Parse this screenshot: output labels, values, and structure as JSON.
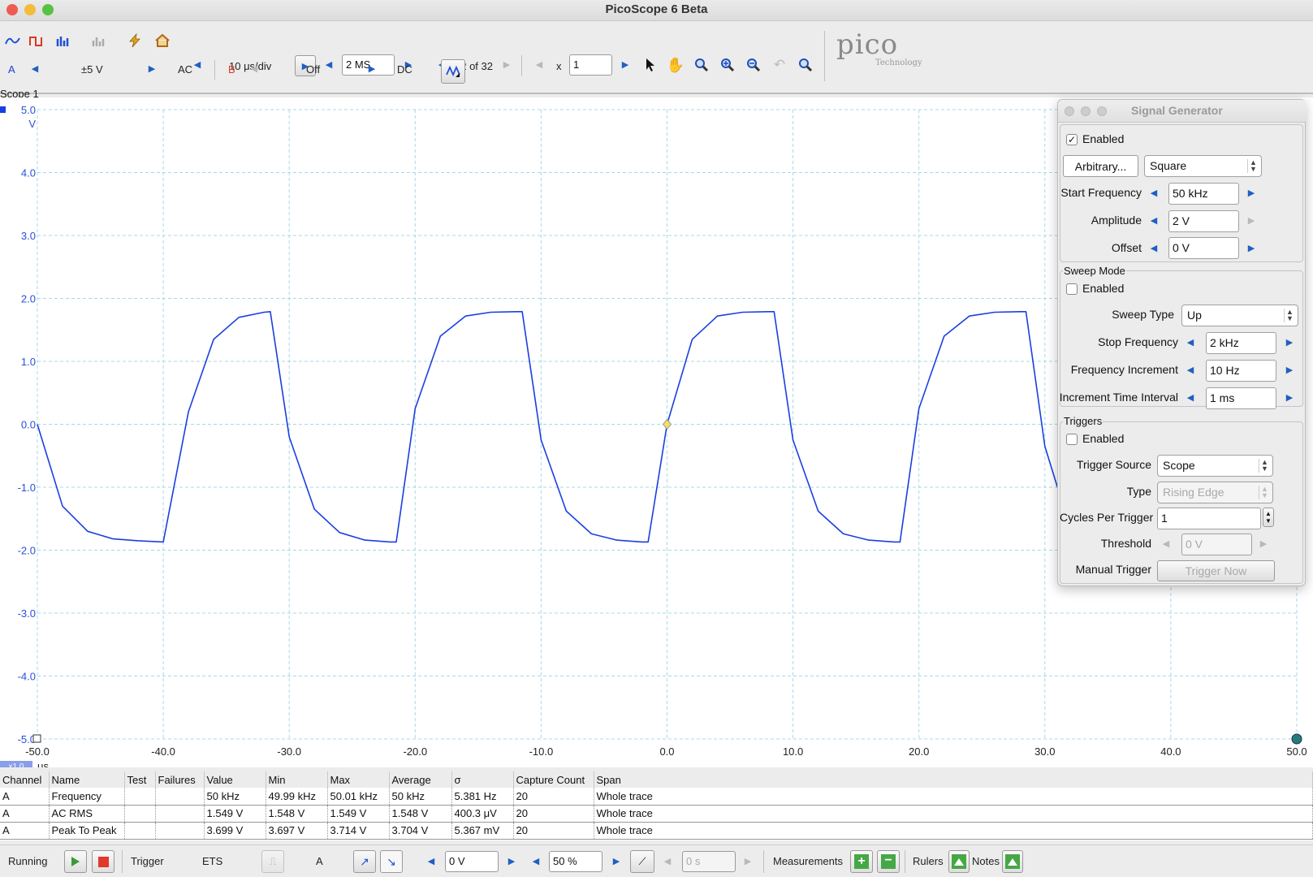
{
  "window": {
    "title": "PicoScope 6 Beta"
  },
  "toolbar": {
    "timebase": "10 μs/div",
    "samples": "2 MS",
    "buffer": "32 of 32",
    "zoom_prefix": "x",
    "zoom_value": "1"
  },
  "channels": {
    "a_label": "A",
    "a_range": "±5 V",
    "a_coupling": "AC",
    "b_label": "B",
    "b_range": "Off",
    "b_coupling": "DC"
  },
  "logo": {
    "brand": "pico",
    "sub": "Technology"
  },
  "scope": {
    "label": "Scope 1",
    "x_scale": "x1.0",
    "x_unit": "μs",
    "y_unit": "V"
  },
  "chart_data": {
    "type": "line",
    "xlim": [
      -50,
      50
    ],
    "ylim": [
      -5,
      5
    ],
    "x_ticks": [
      "-50.0",
      "-40.0",
      "-30.0",
      "-20.0",
      "-10.0",
      "0.0",
      "10.0",
      "20.0",
      "30.0",
      "40.0",
      "50.0"
    ],
    "y_ticks": [
      "5.0",
      "4.0",
      "3.0",
      "2.0",
      "1.0",
      "0.0",
      "-1.0",
      "-2.0",
      "-3.0",
      "-4.0",
      "-5.0"
    ],
    "xlabel": "μs",
    "ylabel": "V",
    "grid": true,
    "series": [
      {
        "color": "#1a3fe0",
        "x": [
          -50,
          -48,
          -46,
          -44,
          -42,
          -40,
          -38,
          -36,
          -34,
          -32,
          -31.5,
          -30,
          -28,
          -26,
          -24,
          -22,
          -21.5,
          -20,
          -18,
          -16,
          -14,
          -12,
          -11.5,
          -10,
          -8,
          -6,
          -4,
          -2,
          -1.5,
          0,
          2,
          4,
          6,
          8,
          8.5,
          10,
          12,
          14,
          16,
          18,
          18.5,
          20,
          22,
          24,
          26,
          28,
          28.5,
          30,
          31
        ],
        "y": [
          0.0,
          -1.3,
          -1.7,
          -1.82,
          -1.85,
          -1.87,
          0.2,
          1.35,
          1.7,
          1.78,
          1.79,
          -0.2,
          -1.35,
          -1.72,
          -1.84,
          -1.87,
          -1.87,
          0.25,
          1.4,
          1.72,
          1.78,
          1.79,
          1.79,
          -0.25,
          -1.38,
          -1.74,
          -1.84,
          -1.87,
          -1.87,
          0.0,
          1.35,
          1.72,
          1.78,
          1.79,
          1.79,
          -0.25,
          -1.38,
          -1.74,
          -1.84,
          -1.87,
          -1.87,
          0.25,
          1.4,
          1.72,
          1.78,
          1.79,
          1.79,
          -0.35,
          -1.0
        ]
      }
    ],
    "trigger_marker": {
      "x": 0,
      "y": 0
    }
  },
  "measurements": {
    "headers": [
      "Channel",
      "Name",
      "Test",
      "Failures",
      "Value",
      "Min",
      "Max",
      "Average",
      "σ",
      "Capture Count",
      "Span"
    ],
    "rows": [
      [
        "A",
        "Frequency",
        "",
        "",
        "50 kHz",
        "49.99 kHz",
        "50.01 kHz",
        "50 kHz",
        "5.381 Hz",
        "20",
        "Whole trace"
      ],
      [
        "A",
        "AC RMS",
        "",
        "",
        "1.549 V",
        "1.548 V",
        "1.549 V",
        "1.548 V",
        "400.3 μV",
        "20",
        "Whole trace"
      ],
      [
        "A",
        "Peak To Peak",
        "",
        "",
        "3.699 V",
        "3.697 V",
        "3.714 V",
        "3.704 V",
        "5.367 mV",
        "20",
        "Whole trace"
      ]
    ]
  },
  "status": {
    "running": "Running",
    "trigger": "Trigger",
    "trigger_mode": "ETS",
    "trigger_channel": "A",
    "threshold": "0 V",
    "pretrigger": "50 %",
    "delay": "0 s",
    "measurements": "Measurements",
    "rulers": "Rulers",
    "notes": "Notes"
  },
  "siggen": {
    "title": "Signal Generator",
    "enabled_label": "Enabled",
    "enabled": true,
    "arbitrary_button": "Arbitrary...",
    "waveform": "Square",
    "start_freq_label": "Start Frequency",
    "start_freq": "50 kHz",
    "amplitude_label": "Amplitude",
    "amplitude": "2 V",
    "offset_label": "Offset",
    "offset": "0 V",
    "sweep_title": "Sweep Mode",
    "sweep_enabled_label": "Enabled",
    "sweep_enabled": false,
    "sweep_type_label": "Sweep Type",
    "sweep_type": "Up",
    "stop_freq_label": "Stop Frequency",
    "stop_freq": "2 kHz",
    "freq_inc_label": "Frequency Increment",
    "freq_inc": "10 Hz",
    "inc_time_label": "Increment Time Interval",
    "inc_time": "1 ms",
    "triggers_title": "Triggers",
    "triggers_enabled_label": "Enabled",
    "triggers_enabled": false,
    "trigger_source_label": "Trigger Source",
    "trigger_source": "Scope",
    "type_label": "Type",
    "type": "Rising Edge",
    "cycles_label": "Cycles Per Trigger",
    "cycles": "1",
    "threshold_label": "Threshold",
    "threshold": "0 V",
    "manual_trigger_label": "Manual Trigger",
    "trigger_now": "Trigger Now"
  }
}
